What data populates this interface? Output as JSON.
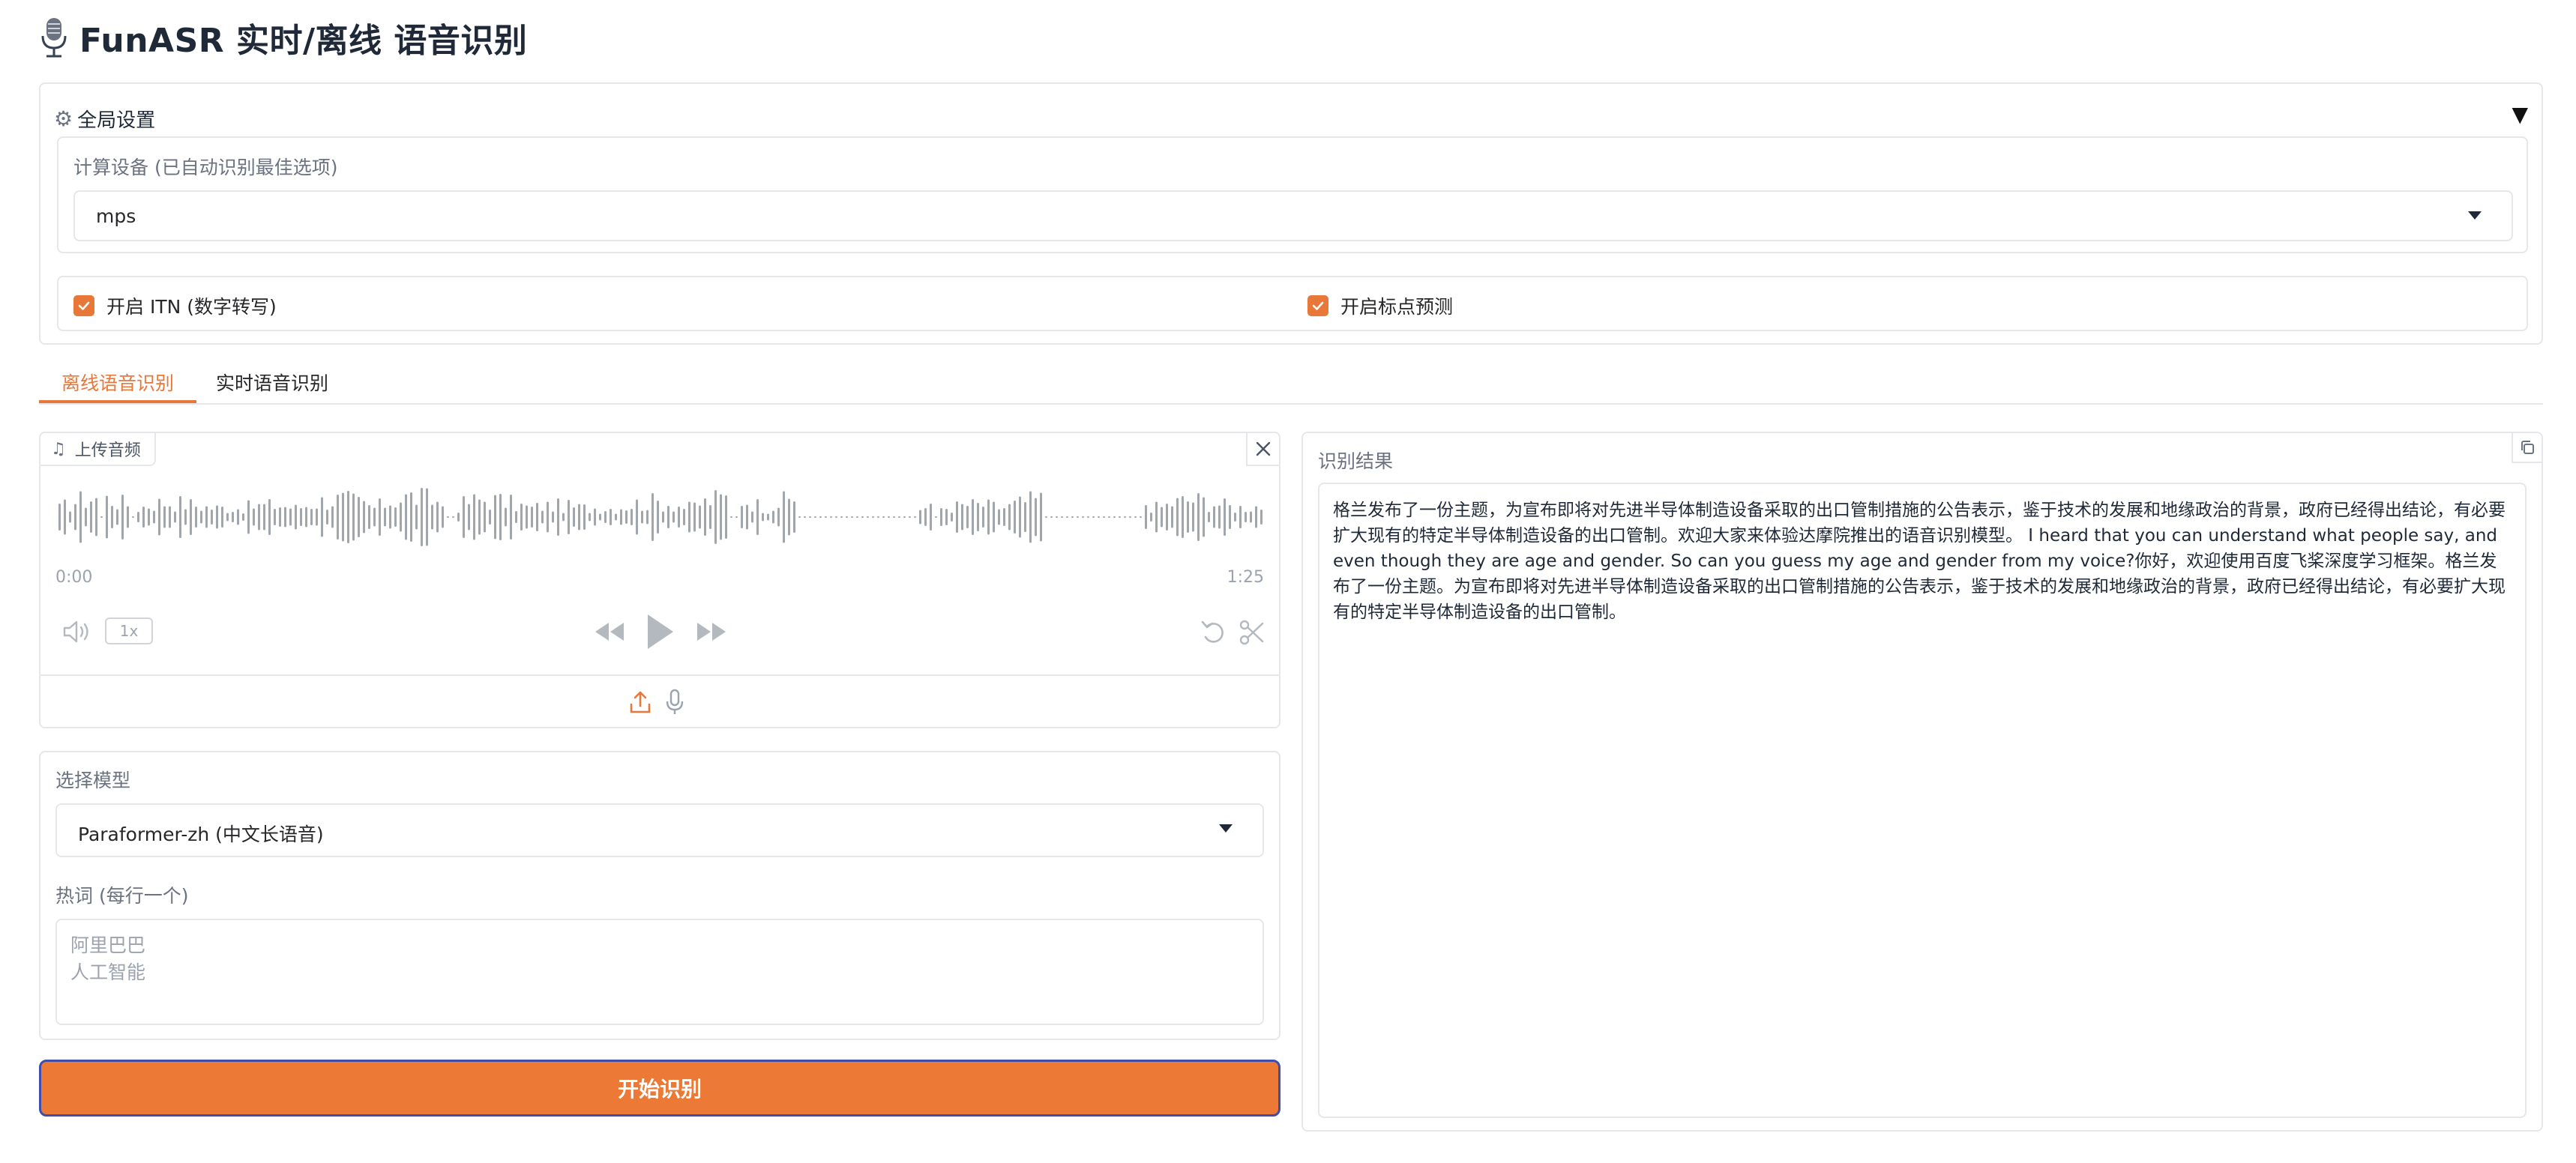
{
  "app": {
    "title": "FunASR 实时/离线 语音识别",
    "accent_color": "#e8773a",
    "title_icon": "microphone-icon"
  },
  "global_settings": {
    "title": "全局设置",
    "icon": "gear-icon",
    "collapse_icon": "▼",
    "device_label": "计算设备 (已自动识别最佳选项)",
    "device_value": "mps",
    "itn_label": "开启 ITN (数字转写)",
    "itn_checked": true,
    "punc_label": "开启标点预测",
    "punc_checked": true
  },
  "tabs": [
    {
      "label": "离线语音识别",
      "active": true
    },
    {
      "label": "实时语音识别",
      "active": false
    }
  ],
  "audio": {
    "label": "上传音频",
    "time_start": "0:00",
    "time_end": "1:25",
    "speed": "1x"
  },
  "model": {
    "label": "选择模型",
    "value": "Paraformer-zh (中文长语音)",
    "hotword_label": "热词 (每行一个)",
    "hotword_placeholder": "阿里巴巴\n人工智能"
  },
  "start_button": "开始识别",
  "result": {
    "label": "识别结果",
    "text": "格兰发布了一份主题，为宣布即将对先进半导体制造设备采取的出口管制措施的公告表示，鉴于技术的发展和地缘政治的背景，政府已经得出结论，有必要扩大现有的特定半导体制造设备的出口管制。欢迎大家来体验达摩院推出的语音识别模型。 I heard that you can understand what people say, and even though they are age and gender. So can you guess my age and gender from my voice?你好，欢迎使用百度飞桨深度学习框架。格兰发布了一份主题。为宣布即将对先进半导体制造设备采取的出口管制措施的公告表示，鉴于技术的发展和地缘政治的背景，政府已经得出结论，有必要扩大现有的特定半导体制造设备的出口管制。"
  }
}
